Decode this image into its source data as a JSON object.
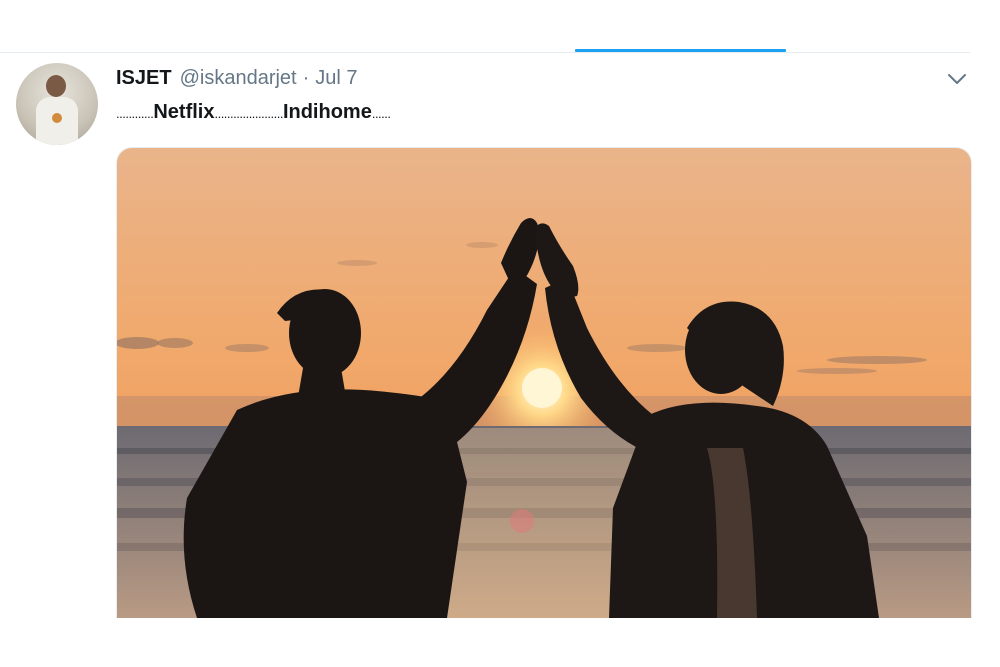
{
  "tweet": {
    "display_name": "ISJET",
    "handle": "@iskandarjet",
    "separator": "·",
    "date": "Jul 7",
    "text": {
      "dots_1": "............",
      "word_1": "Netflix",
      "dots_2": "......................",
      "word_2": "Indihome",
      "dots_3": "......"
    },
    "avatar_icon": "user-avatar",
    "caret_icon": "chevron-down-icon",
    "media": {
      "icon": "photo-two-men-high-five-at-sunset-beach"
    }
  },
  "colors": {
    "accent": "#1da1f2",
    "name": "#14171a",
    "secondary_text": "#657786",
    "divider": "#e6ecf0"
  }
}
